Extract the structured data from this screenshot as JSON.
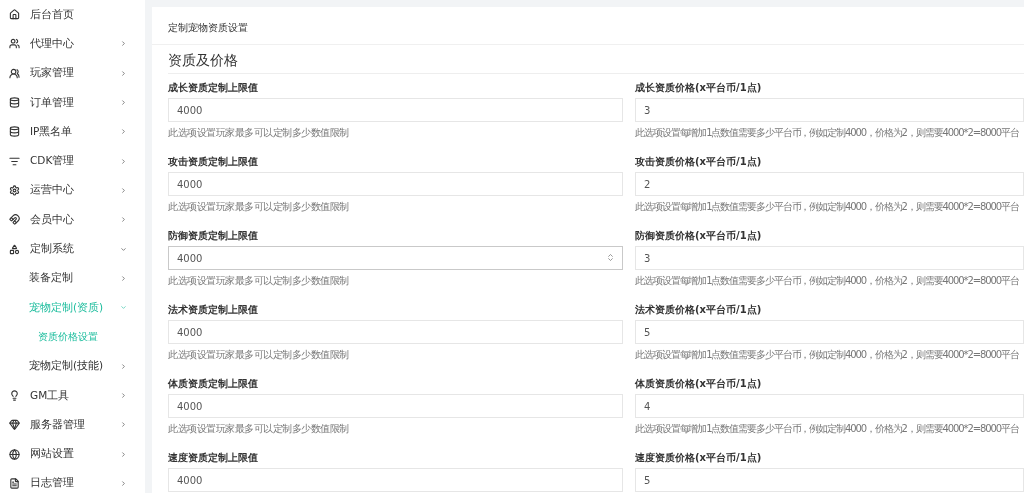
{
  "sidebar": {
    "items": [
      {
        "label": "后台首页",
        "selected": false
      },
      {
        "label": "代理中心",
        "expanded": false
      },
      {
        "label": "玩家管理",
        "expanded": false
      },
      {
        "label": "订单管理",
        "expanded": false
      },
      {
        "label": "IP黑名单",
        "expanded": false
      },
      {
        "label": "CDK管理",
        "expanded": false
      },
      {
        "label": "运营中心",
        "expanded": false
      },
      {
        "label": "会员中心",
        "expanded": false
      },
      {
        "label": "定制系统",
        "expanded": true,
        "children": [
          {
            "label": "装备定制",
            "expanded": false
          },
          {
            "label": "宠物定制(资质)",
            "expanded": true,
            "children": [
              {
                "label": "资质价格设置",
                "selected": true
              }
            ]
          },
          {
            "label": "宠物定制(技能)",
            "expanded": false
          }
        ]
      },
      {
        "label": "GM工具",
        "expanded": false
      },
      {
        "label": "服务器管理",
        "expanded": false
      },
      {
        "label": "网站设置",
        "expanded": false
      },
      {
        "label": "日志管理",
        "expanded": false
      }
    ]
  },
  "card": {
    "title": "定制宠物资质设置",
    "section_title": "资质及价格",
    "rows": [
      {
        "limit": {
          "label": "成长资质定制上限值",
          "value": "4000",
          "hint": "此选项设置玩家最多可以定制多少数值限制",
          "hovered": false
        },
        "price": {
          "label": "成长资质价格(x平台币/1点)",
          "value": "3",
          "hint": "此选项设置每增加1点数值需要多少平台币，例如定制4000，价格为2，则需要4000*2=8000平台"
        }
      },
      {
        "limit": {
          "label": "攻击资质定制上限值",
          "value": "4000",
          "hint": "此选项设置玩家最多可以定制多少数值限制",
          "hovered": false
        },
        "price": {
          "label": "攻击资质价格(x平台币/1点)",
          "value": "2",
          "hint": "此选项设置每增加1点数值需要多少平台币，例如定制4000，价格为2，则需要4000*2=8000平台"
        }
      },
      {
        "limit": {
          "label": "防御资质定制上限值",
          "value": "4000",
          "hint": "此选项设置玩家最多可以定制多少数值限制",
          "hovered": true
        },
        "price": {
          "label": "防御资质价格(x平台币/1点)",
          "value": "3",
          "hint": "此选项设置每增加1点数值需要多少平台币，例如定制4000，价格为2，则需要4000*2=8000平台"
        }
      },
      {
        "limit": {
          "label": "法术资质定制上限值",
          "value": "4000",
          "hint": "此选项设置玩家最多可以定制多少数值限制",
          "hovered": false
        },
        "price": {
          "label": "法术资质价格(x平台币/1点)",
          "value": "5",
          "hint": "此选项设置每增加1点数值需要多少平台币，例如定制4000，价格为2，则需要4000*2=8000平台"
        }
      },
      {
        "limit": {
          "label": "体质资质定制上限值",
          "value": "4000",
          "hint": "此选项设置玩家最多可以定制多少数值限制",
          "hovered": false
        },
        "price": {
          "label": "体质资质价格(x平台币/1点)",
          "value": "4",
          "hint": "此选项设置每增加1点数值需要多少平台币，例如定制4000，价格为2，则需要4000*2=8000平台"
        }
      },
      {
        "limit": {
          "label": "速度资质定制上限值",
          "value": "4000",
          "hovered": false
        },
        "price": {
          "label": "速度资质价格(x平台币/1点)",
          "value": "5"
        }
      }
    ]
  }
}
